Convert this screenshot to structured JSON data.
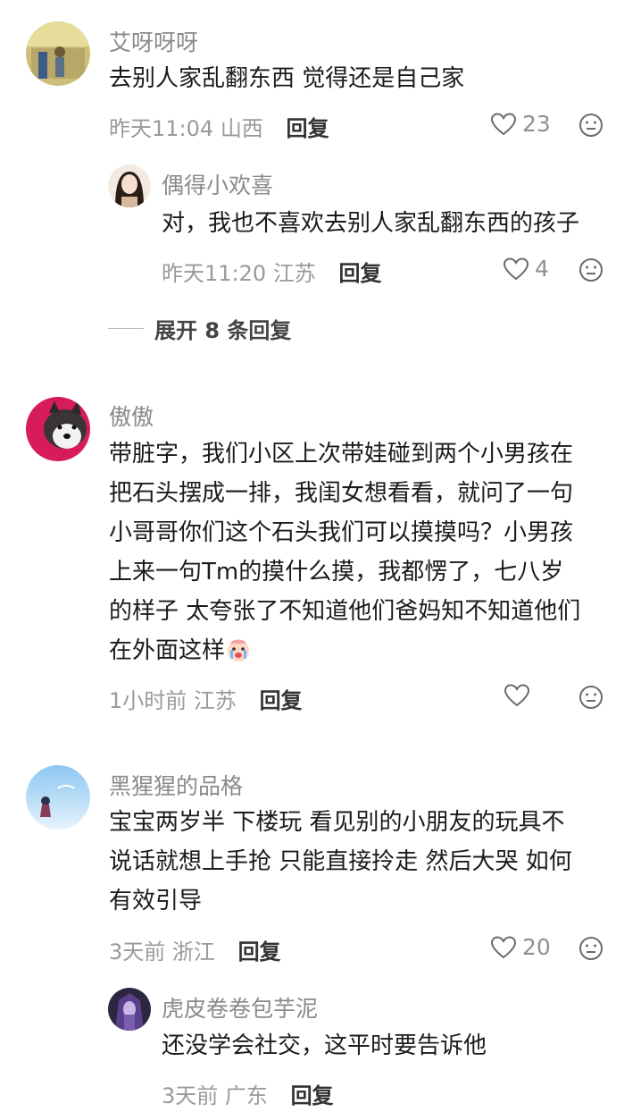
{
  "comments": [
    {
      "username": "艾呀呀呀",
      "text": [
        "去别人家乱翻东西 觉得还是自己家"
      ],
      "time": "昨天11:04",
      "location": "山西",
      "reply_label": "回复",
      "likes": "23",
      "replies": [
        {
          "username": "偶得小欢喜",
          "text": [
            "对，我也不喜欢去别人家乱翻东西的孩子"
          ],
          "time": "昨天11:20",
          "location": "江苏",
          "reply_label": "回复",
          "likes": "4"
        }
      ],
      "expand_label": "展开 8 条回复"
    },
    {
      "username": "傲傲",
      "text": [
        "带脏字，我们小区上次带娃碰到两个小男孩在",
        "把石头摆成一排，我闺女想看看，就问了一句",
        "小哥哥你们这个石头我们可以摸摸吗？小男孩",
        "上来一句Tm的摸什么摸，我都愣了，七八岁",
        "的样子 太夸张了不知道他们爸妈知不知道他们",
        "在外面这样"
      ],
      "time": "1小时前",
      "location": "江苏",
      "reply_label": "回复",
      "likes": ""
    },
    {
      "username": "黑猩猩的品格",
      "text": [
        "宝宝两岁半 下楼玩 看见别的小朋友的玩具不",
        "说话就想上手抢 只能直接拎走 然后大哭 如何",
        "有效引导"
      ],
      "time": "3天前",
      "location": "浙江",
      "reply_label": "回复",
      "likes": "20",
      "replies": [
        {
          "username": "虎皮卷卷包芋泥",
          "text": [
            "还没学会社交，这平时要告诉他"
          ],
          "time": "3天前",
          "location": "广东",
          "reply_label": "回复"
        }
      ]
    }
  ],
  "icons": {
    "like": "heart-outline-icon",
    "dislike": "sad-face-icon",
    "emoji": "crying-face-emoji"
  },
  "colors": {
    "text": "#1b1b1b",
    "username": "#8a8a8a",
    "meta": "#9a9a9a",
    "icon": "#6b6b6b"
  }
}
